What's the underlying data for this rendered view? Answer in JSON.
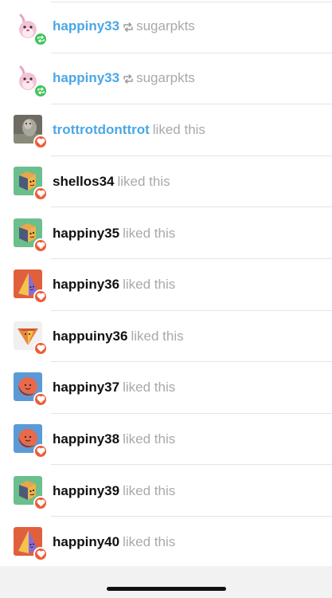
{
  "notes": [
    {
      "kind": "reblog",
      "user": "happiny33",
      "avatar_icon": "bird-avatar-icon",
      "source": "sugarpkts",
      "reblog_icon": "reblog-icon"
    },
    {
      "kind": "reblog",
      "user": "happiny33",
      "avatar_icon": "bird-avatar-icon",
      "source": "sugarpkts",
      "reblog_icon": "reblog-icon"
    },
    {
      "kind": "like",
      "user": "trottrotdonttrot",
      "action": "liked this",
      "avatar_icon": "photo-avatar-icon"
    },
    {
      "kind": "like",
      "user": "shellos34",
      "action": "liked this",
      "avatar_icon": "cube-avatar-icon"
    },
    {
      "kind": "like",
      "user": "happiny35",
      "action": "liked this",
      "avatar_icon": "cube-avatar-icon"
    },
    {
      "kind": "like",
      "user": "happiny36",
      "action": "liked this",
      "avatar_icon": "pyramid-avatar-icon"
    },
    {
      "kind": "like",
      "user": "happuiny36",
      "action": "liked this",
      "avatar_icon": "cone-avatar-icon"
    },
    {
      "kind": "like",
      "user": "happiny37",
      "action": "liked this",
      "avatar_icon": "ball-avatar-icon"
    },
    {
      "kind": "like",
      "user": "happiny38",
      "action": "liked this",
      "avatar_icon": "ball-avatar-icon"
    },
    {
      "kind": "like",
      "user": "happiny39",
      "action": "liked this",
      "avatar_icon": "cube-avatar-icon"
    },
    {
      "kind": "like",
      "user": "happiny40",
      "action": "liked this",
      "avatar_icon": "pyramid-avatar-icon"
    }
  ],
  "colors": {
    "link_blue": "#4aa7e6",
    "muted_text": "#a9a9a9",
    "like_badge": "#ef5b36",
    "reblog_badge": "#3fc45a",
    "cube_bg": "#6bbf8c",
    "pyramid_bg": "#e0603d",
    "ball_bg": "#5b9ad8",
    "cone_bg": "#f0f0f0"
  }
}
